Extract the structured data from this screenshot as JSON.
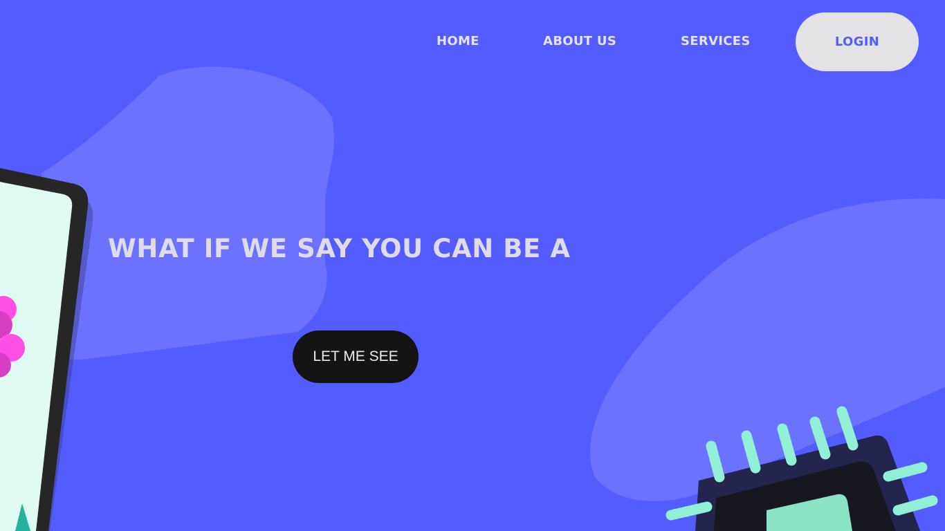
{
  "nav": {
    "home_label": "HOME",
    "about_label": "ABOUT US",
    "services_label": "SERVICES",
    "login_label": "LOGIN"
  },
  "hero": {
    "headline": "WHAT IF WE SAY YOU CAN BE A",
    "cta_label": "LET ME SEE"
  },
  "colors": {
    "background": "#525cff",
    "login_button_bg": "#e3e3e6",
    "cta_button_bg": "#141414",
    "text_light": "#dedce8"
  },
  "illustrations": [
    "tablet-illustration",
    "chip-illustration"
  ]
}
